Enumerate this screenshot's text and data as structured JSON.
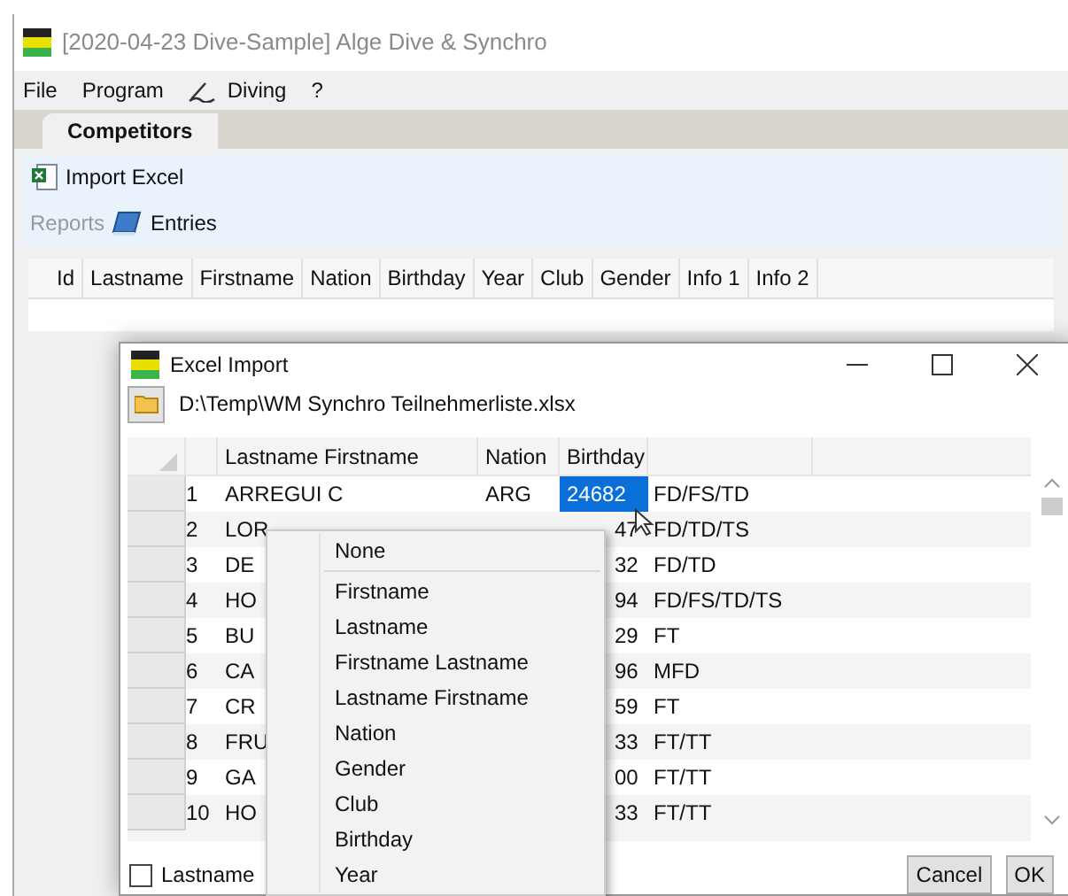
{
  "window": {
    "title": "[2020-04-23 Dive-Sample] Alge Dive & Synchro"
  },
  "menu": [
    {
      "label": "File",
      "has_icon": false
    },
    {
      "label": "Program",
      "has_icon": false
    },
    {
      "label": "Diving",
      "has_icon": true
    },
    {
      "label": "?",
      "has_icon": false
    }
  ],
  "tabs": [
    {
      "label": "Competitors",
      "selected": true
    }
  ],
  "toolbar": [
    [
      {
        "label": "Import Excel",
        "kind": "excel",
        "disabled": false
      }
    ],
    [
      {
        "label": "Reports",
        "kind": "text",
        "disabled": true
      },
      {
        "label": "Entries",
        "kind": "book",
        "disabled": false
      }
    ]
  ],
  "table": {
    "columns": [
      "Id",
      "Lastname",
      "Firstname",
      "Nation",
      "Birthday",
      "Year",
      "Club",
      "Gender",
      "Info 1",
      "Info 2"
    ]
  },
  "dialog": {
    "title": "Excel Import",
    "path": "D:\\Temp\\WM Synchro Teilnehmerliste.xlsx",
    "columns": [
      "Lastname Firstname",
      "Nation",
      "Birthday"
    ],
    "rows": [
      {
        "number": "1",
        "name": "ARREGUI C",
        "nation": "ARG",
        "birthday": "24682",
        "events": "FD/FS/TD",
        "selected": true
      },
      {
        "number": "2",
        "name": "LOR",
        "nation": "",
        "birthday": "47",
        "events": "FD/TD/TS",
        "selected": false
      },
      {
        "number": "3",
        "name": "DE",
        "nation": "",
        "birthday": "32",
        "events": "FD/TD",
        "selected": false
      },
      {
        "number": "4",
        "name": "HO",
        "nation": "",
        "birthday": "94",
        "events": "FD/FS/TD/TS",
        "selected": false
      },
      {
        "number": "5",
        "name": "BU",
        "nation": "",
        "birthday": "29",
        "events": "FT",
        "selected": false
      },
      {
        "number": "6",
        "name": "CA",
        "nation": "",
        "birthday": "96",
        "events": "MFD",
        "selected": false
      },
      {
        "number": "7",
        "name": "CR",
        "nation": "",
        "birthday": "59",
        "events": "FT",
        "selected": false
      },
      {
        "number": "8",
        "name": "FRU",
        "nation": "",
        "birthday": "33",
        "events": "FT/TT",
        "selected": false
      },
      {
        "number": "9",
        "name": "GA",
        "nation": "",
        "birthday": "00",
        "events": "FT/TT",
        "selected": false
      },
      {
        "number": "10",
        "name": "HO",
        "nation": "",
        "birthday": "33",
        "events": "FT/TT",
        "selected": false
      }
    ],
    "checkbox": {
      "label": "Lastname",
      "checked": false
    },
    "buttons": [
      "Cancel",
      "OK"
    ]
  },
  "context_menu": {
    "items": [
      {
        "kind": "item",
        "label": "None"
      },
      {
        "kind": "separator"
      },
      {
        "kind": "item",
        "label": "Firstname"
      },
      {
        "kind": "item",
        "label": "Lastname"
      },
      {
        "kind": "item",
        "label": "Firstname Lastname"
      },
      {
        "kind": "item",
        "label": "Lastname Firstname"
      },
      {
        "kind": "item",
        "label": "Nation"
      },
      {
        "kind": "item",
        "label": "Gender"
      },
      {
        "kind": "item",
        "label": "Club"
      },
      {
        "kind": "item",
        "label": "Birthday"
      },
      {
        "kind": "item",
        "label": "Year"
      }
    ]
  }
}
